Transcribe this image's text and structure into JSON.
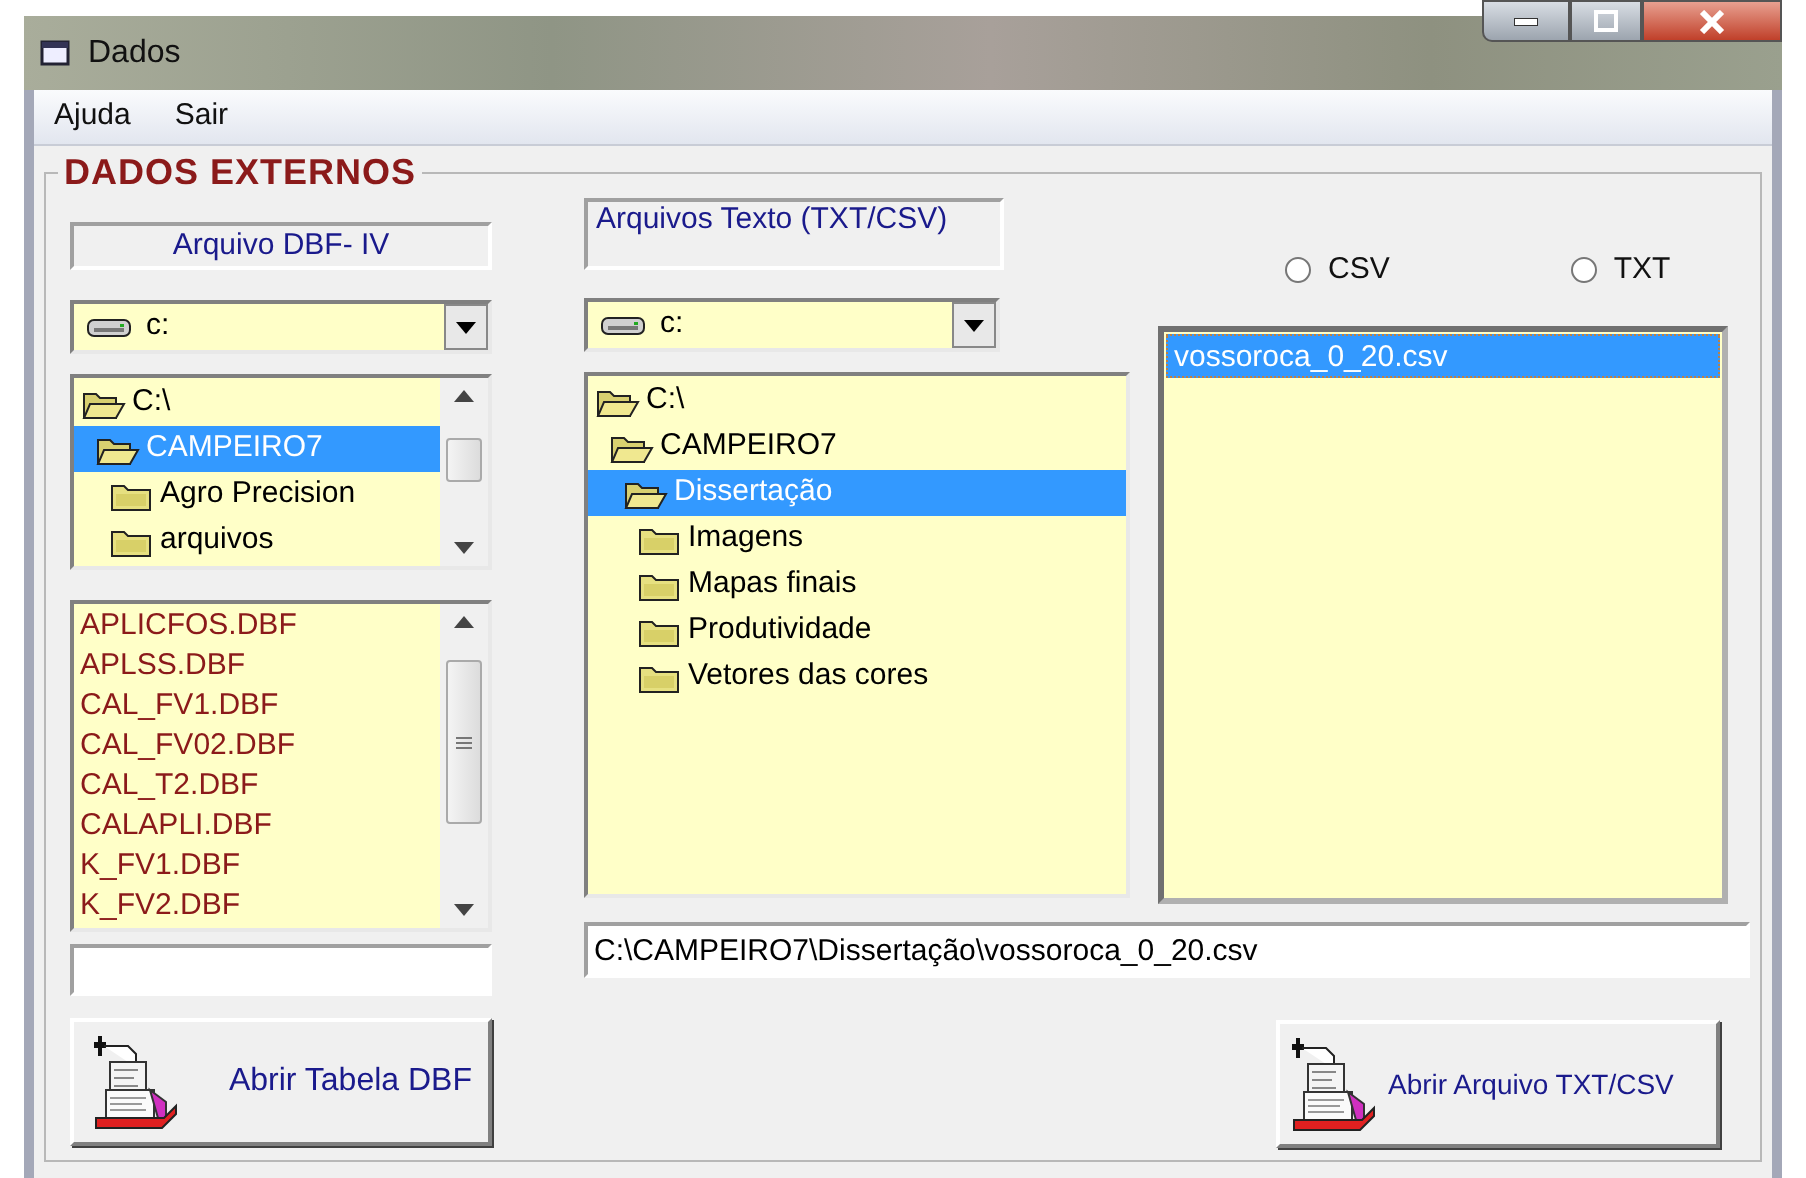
{
  "window": {
    "title": "Dados"
  },
  "menu": [
    {
      "label": "Ajuda"
    },
    {
      "label": "Sair"
    }
  ],
  "group": {
    "title": "DADOS EXTERNOS"
  },
  "dbf": {
    "label": "Arquivo DBF- IV",
    "drive": "c:",
    "folders": [
      {
        "name": "C:\\",
        "expanded": true,
        "selected": false,
        "children": [
          {
            "name": "CAMPEIRO7",
            "expanded": true,
            "selected": true,
            "children": [
              {
                "name": "Agro Precision",
                "expanded": false,
                "selected": false
              },
              {
                "name": "arquivos",
                "expanded": false,
                "selected": false
              }
            ]
          }
        ]
      }
    ],
    "files": [
      "APLICFOS.DBF",
      "APLSS.DBF",
      "CAL_FV1.DBF",
      "CAL_FV02.DBF",
      "CAL_T2.DBF",
      "CALAPLI.DBF",
      "K_FV1.DBF",
      "K_FV2.DBF"
    ],
    "button": "Abrir Tabela DBF"
  },
  "text_files": {
    "label": "Arquivos Texto (TXT/CSV)",
    "drive": "c:",
    "folders": [
      {
        "name": "C:\\",
        "expanded": true,
        "selected": false,
        "children": [
          {
            "name": "CAMPEIRO7",
            "expanded": true,
            "selected": false,
            "children": [
              {
                "name": "Dissertação",
                "expanded": true,
                "selected": true,
                "children": [
                  {
                    "name": "Imagens",
                    "expanded": false,
                    "selected": false
                  },
                  {
                    "name": "Mapas finais",
                    "expanded": false,
                    "selected": false
                  },
                  {
                    "name": "Produtividade",
                    "expanded": false,
                    "selected": false
                  },
                  {
                    "name": "Vetores das cores",
                    "expanded": false,
                    "selected": false
                  }
                ]
              }
            ]
          }
        ]
      }
    ],
    "formats": [
      {
        "label": "CSV",
        "selected": false
      },
      {
        "label": "TXT",
        "selected": false
      }
    ],
    "files": [
      {
        "name": "vossoroca_0_20.csv",
        "selected": true
      }
    ],
    "path": "C:\\CAMPEIRO7\\Dissertação\\vossoroca_0_20.csv",
    "button": "Abrir Arquivo TXT/CSV"
  }
}
